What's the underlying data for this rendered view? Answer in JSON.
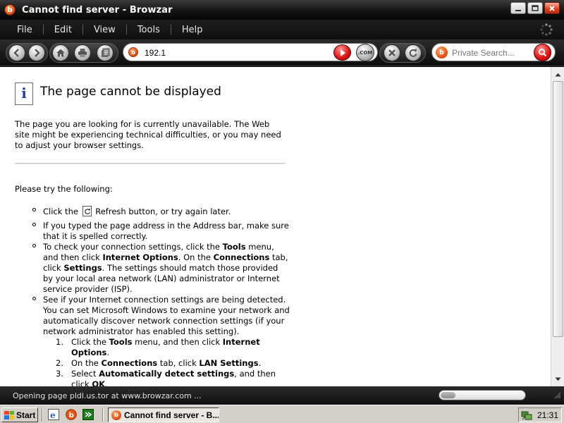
{
  "window": {
    "title": "Cannot find server - Browzar",
    "logo_letter": "b",
    "minimize_icon": "minimize-icon",
    "maximize_icon": "maximize-icon",
    "close_icon": "close-icon"
  },
  "menu": {
    "items": [
      {
        "label": "File"
      },
      {
        "label": "Edit"
      },
      {
        "label": "View"
      },
      {
        "label": "Tools"
      },
      {
        "label": "Help"
      }
    ]
  },
  "toolbar": {
    "address_value": "192.1",
    "com_label": ".COM",
    "search_placeholder": "Private Search...",
    "icons": [
      "back-icon",
      "forward-icon",
      "home-icon",
      "print-icon",
      "page-icon",
      "go-icon",
      "stop-icon",
      "refresh-icon",
      "search-icon"
    ]
  },
  "page": {
    "heading": "The page cannot be displayed",
    "intro": "The page you are looking for is currently unavailable. The Web site might be experiencing technical difficulties, or you may need to adjust your browser settings.",
    "try_label": "Please try the following:",
    "tip1_before": "Click the",
    "tip1_after": "Refresh button, or try again later.",
    "tip2": "If you typed the page address in the Address bar, make sure that it is spelled correctly.",
    "tip3": {
      "t1": "To check your connection settings, click the ",
      "b1": "Tools",
      "t2": " menu, and then click ",
      "b2": "Internet Options",
      "t3": ". On the ",
      "b3": "Connections",
      "t4": " tab, click ",
      "b4": "Settings",
      "t5": ". The settings should match those provided by your local area network (LAN) administrator or Internet service provider (ISP)."
    },
    "tip4": "See if your Internet connection settings are being detected. You can set Microsoft Windows to examine your network and automatically discover network connection settings (if your network administrator has enabled this setting).",
    "steps": [
      {
        "num": "1.",
        "t1": "Click the ",
        "b1": "Tools",
        "t2": " menu, and then click ",
        "b2": "Internet Options",
        "t3": "."
      },
      {
        "num": "2.",
        "t1": "On the ",
        "b1": "Connections",
        "t2": " tab, click ",
        "b2": "LAN Settings",
        "t3": "."
      },
      {
        "num": "3.",
        "t1": "Select ",
        "b1": "Automatically detect settings",
        "t2": ", and then click ",
        "b2": "OK",
        "t3": "."
      }
    ]
  },
  "status": {
    "text": "Opening page pldl.us.tor at www.browzar.com ...",
    "progress": 0.18
  },
  "taskbar": {
    "start_label": "Start",
    "task_label": "Cannot find server - B...",
    "clock": "21:31"
  }
}
